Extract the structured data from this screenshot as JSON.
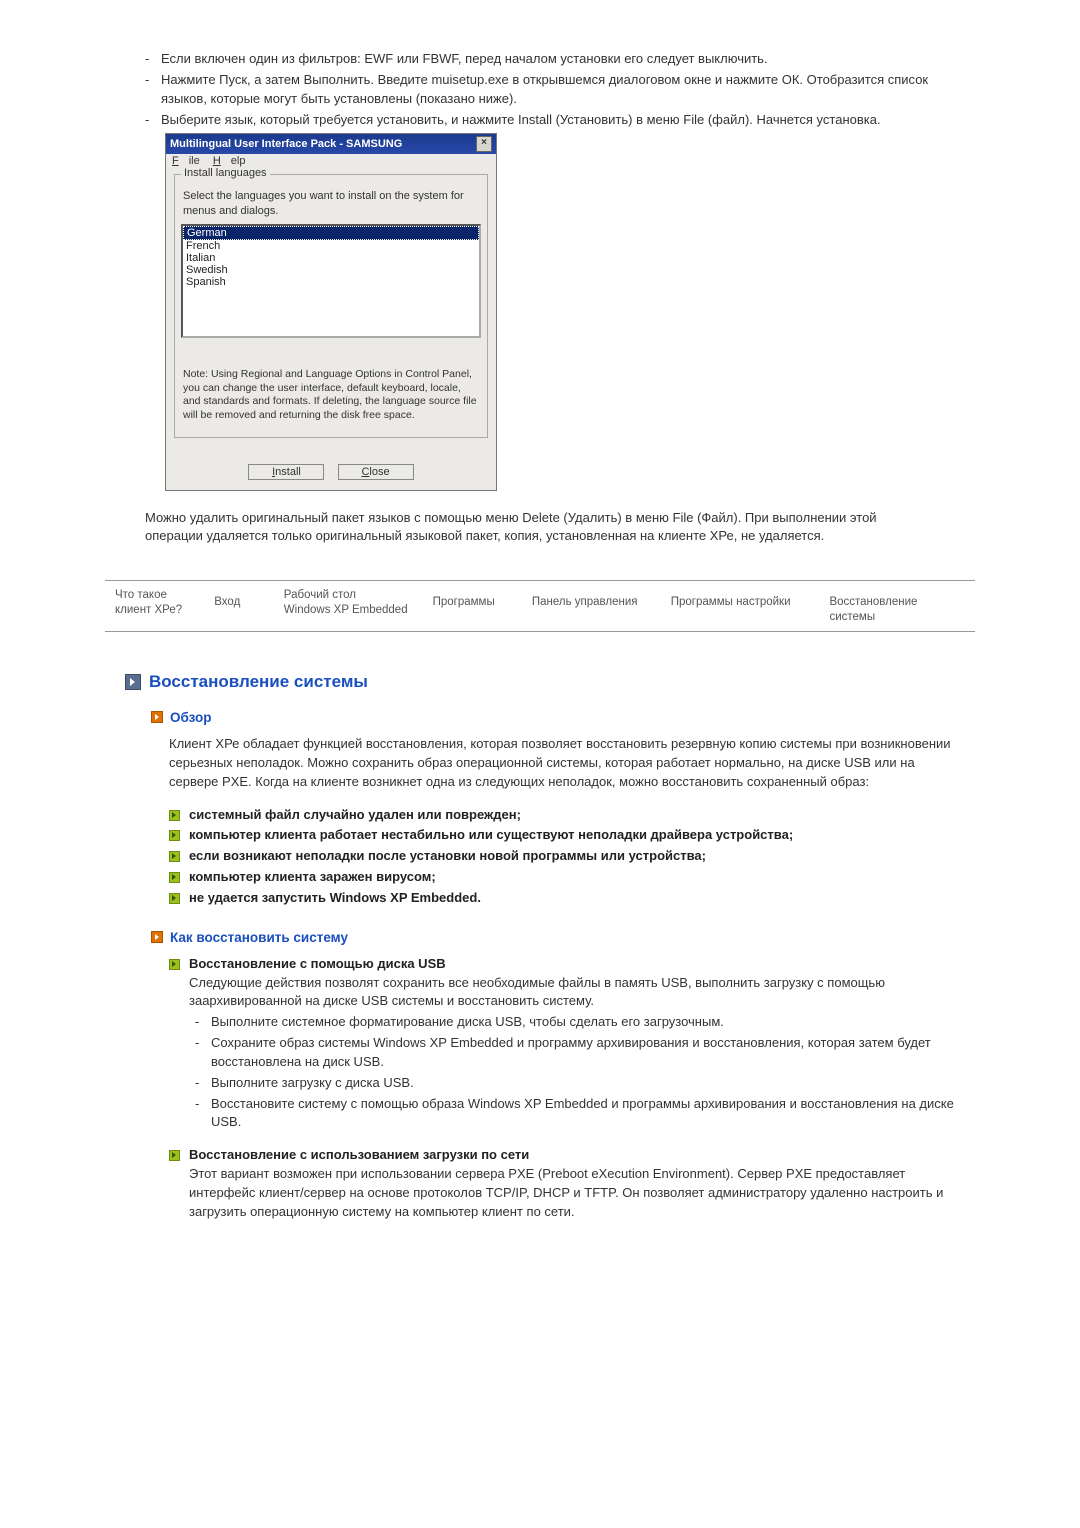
{
  "top_list": [
    "Если включен один из фильтров: EWF или FBWF, перед началом установки его следует выключить.",
    "Нажмите Пуск, а затем Выполнить. Введите muisetup.exe в открывшемся диалоговом окне и нажмите ОК. Отобразится список языков, которые могут быть установлены (показано ниже).",
    "Выберите язык, который требуется установить, и нажмите Install (Установить) в меню File (файл). Начнется установка."
  ],
  "win": {
    "title": "Multilingual User Interface Pack - SAMSUNG",
    "menu_file": "File",
    "menu_help": "Help",
    "legend": "Install languages",
    "instruct": "Select the languages you want to install on the system for menus and dialogs.",
    "items": [
      "German",
      "French",
      "Italian",
      "Swedish",
      "Spanish"
    ],
    "note": "Note: Using Regional and Language Options in Control Panel, you can change the user interface, default keyboard, locale, and standards and formats. If deleting, the language source file will be removed and returning the disk free space.",
    "install": "Install",
    "close": "Close"
  },
  "mid_para": "Можно удалить оригинальный пакет языков с помощью меню Delete (Удалить) в меню File (Файл). При выполнении этой операции удаляется только оригинальный языковой пакет, копия, установленная на клиенте ХРе, не удаляется.",
  "nav": [
    "Что такое\nклиент ХРе?",
    "Вход",
    "Рабочий стол\nWindows XP Embedded",
    "Программы",
    "Панель управления",
    "Программы настройки",
    "Восстановление системы"
  ],
  "sec_title": "Восстановление системы",
  "overview_h": "Обзор",
  "overview_p": "Клиент ХРе обладает функцией восстановления, которая позволяет восстановить резервную копию системы при возникновении серьезных неполадок. Можно сохранить образ операционной системы, которая работает нормально, на диске USB или на сервере PXE. Когда на клиенте возникнет одна из следующих неполадок, можно восстановить сохраненный образ:",
  "cases": [
    "системный файл случайно удален или поврежден;",
    "компьютер клиента работает нестабильно или существуют неполадки драйвера устройства;",
    "если возникают неполадки после установки новой программы или устройства;",
    "компьютер клиента заражен вирусом;",
    "не удается запустить Windows XP Embedded."
  ],
  "howto_h": "Как восстановить систему",
  "usb": {
    "title": "Восстановление с помощью диска USB",
    "intro": "Следующие действия позволят сохранить все необходимые файлы в память USB, выполнить загрузку с помощью заархивированной на диске USB системы и восстановить систему.",
    "steps": [
      "Выполните системное форматирование диска USB, чтобы сделать его загрузочным.",
      "Сохраните образ системы Windows XP Embedded и программу архивирования и восстановления, которая затем будет восстановлена на диск USB.",
      "Выполните загрузку с диска USB.",
      "Восстановите систему с помощью образа Windows XP Embedded и программы архивирования и восстановления на диске USB."
    ]
  },
  "net": {
    "title": "Восстановление с использованием загрузки по сети",
    "body": "Этот вариант возможен при использовании сервера PXE (Preboot eXecution Environment). Сервер PXE предоставляет интерфейс клиент/сервер на основе протоколов TCP/IP, DHCP и TFTP. Он позволяет администратору удаленно настроить и загрузить операционную систему на компьютер клиент по сети."
  }
}
